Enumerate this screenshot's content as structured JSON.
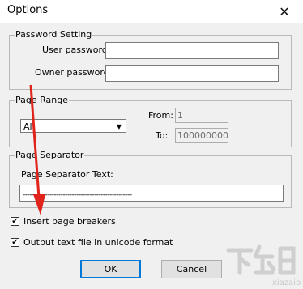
{
  "window": {
    "title": "Options",
    "close_glyph": "✕"
  },
  "password_group": {
    "legend": "Password Setting",
    "user_label": "User password:",
    "user_value": "",
    "owner_label": "Owner password:",
    "owner_value": ""
  },
  "range_group": {
    "legend": "Page Range",
    "selected": "All",
    "from_label": "From:",
    "from_value": "1",
    "to_label": "To:",
    "to_value": "100000000"
  },
  "separator_group": {
    "legend": "Page Separator",
    "text_label": "Page Separator Text:",
    "text_value": "-------------------------------------------------"
  },
  "options": {
    "insert_breaks_label": "Insert page breakers",
    "insert_breaks_checked": true,
    "unicode_label": "Output text file in unicode format",
    "unicode_checked": true,
    "check_glyph": "✔"
  },
  "buttons": {
    "ok": "OK",
    "cancel": "Cancel"
  },
  "annotation": {
    "arrow_color": "#e0241c"
  },
  "watermark": {
    "text": "下载吧"
  }
}
